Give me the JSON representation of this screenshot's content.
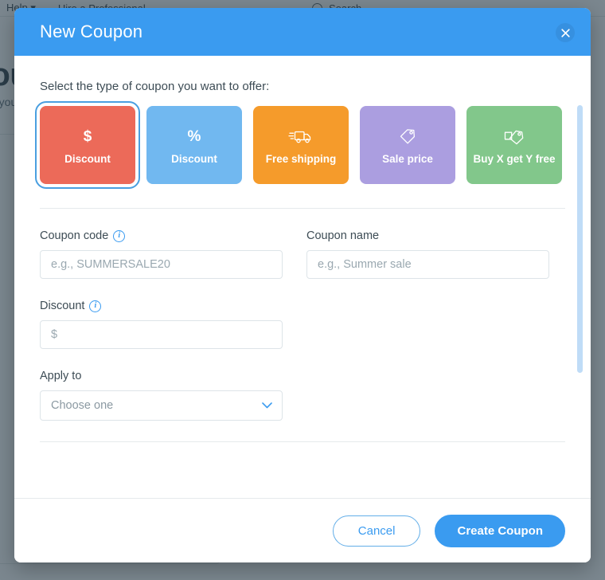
{
  "background": {
    "nav": {
      "help_label": "Help",
      "help_caret": "⌄",
      "hire_label": "Hire a Professional",
      "search_label": "Search",
      "search_icon": "search-icon"
    },
    "heading": "Coupons",
    "subheading": "Give your customers a reason to buy"
  },
  "modal": {
    "title": "New Coupon",
    "close_icon": "close-icon",
    "prompt": "Select the type of coupon you want to offer:",
    "coupon_types": [
      {
        "id": "amount-discount",
        "icon": "dollar-icon",
        "icon_glyph": "$",
        "label": "Discount",
        "color": "#ec6a59",
        "selected": true
      },
      {
        "id": "percent-discount",
        "icon": "percent-icon",
        "icon_glyph": "%",
        "label": "Discount",
        "color": "#71b8f0",
        "selected": false
      },
      {
        "id": "free-shipping",
        "icon": "truck-icon",
        "icon_glyph": "",
        "label": "Free shipping",
        "color": "#f59b2b",
        "selected": false
      },
      {
        "id": "sale-price",
        "icon": "tag-icon",
        "icon_glyph": "",
        "label": "Sale price",
        "color": "#ab9ee0",
        "selected": false
      },
      {
        "id": "buy-x-get-y",
        "icon": "tags-icon",
        "icon_glyph": "",
        "label": "Buy X get Y free",
        "color": "#82c78b",
        "selected": false
      }
    ],
    "fields": {
      "coupon_code": {
        "label": "Coupon code",
        "info_icon": "info-icon",
        "placeholder": "e.g., SUMMERSALE20",
        "value": ""
      },
      "coupon_name": {
        "label": "Coupon name",
        "placeholder": "e.g., Summer sale",
        "value": ""
      },
      "discount": {
        "label": "Discount",
        "info_icon": "info-icon",
        "placeholder": "$",
        "value": ""
      },
      "apply_to": {
        "label": "Apply to",
        "selected": "Choose one",
        "chevron_icon": "chevron-down-icon"
      }
    },
    "footer": {
      "cancel_label": "Cancel",
      "create_label": "Create Coupon"
    }
  },
  "colors": {
    "header_blue": "#3a9bf0",
    "primary_blue": "#3a9bf0",
    "selected_ring": "#4a9fe0",
    "scrollbar_thumb": "#bfdcf7",
    "overlay": "rgba(42,61,74,0.62)"
  }
}
